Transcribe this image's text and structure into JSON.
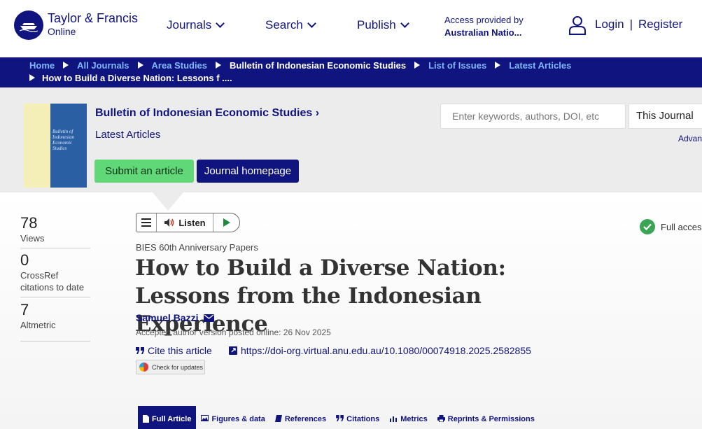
{
  "header": {
    "brand_line1": "Taylor & Francis",
    "brand_line2": "Online",
    "nav": [
      {
        "label": "Journals"
      },
      {
        "label": "Search"
      },
      {
        "label": "Publish"
      }
    ],
    "access_label": "Access provided by",
    "access_institution": "Australian Natio...",
    "login": "Login",
    "separator": "|",
    "register": "Register"
  },
  "breadcrumb": {
    "items": [
      "Home",
      "All Journals",
      "Area Studies",
      "Bulletin of Indonesian Economic Studies",
      "List of Issues",
      "Latest Articles"
    ],
    "current": "How to Build a Diverse Nation: Lessons f ...."
  },
  "journal": {
    "title": "Bulletin of Indonesian Economic Studies",
    "title_chevron": "›",
    "subtitle": "Latest Articles",
    "submit_label": "Submit an article",
    "homepage_label": "Journal homepage",
    "cover_text": "Bulletin of Indonesian Economic Studies"
  },
  "search": {
    "placeholder": "Enter keywords, authors, DOI, etc",
    "scope": "This Journal",
    "advanced": "Advan"
  },
  "metrics": [
    {
      "value": "78",
      "label": "Views"
    },
    {
      "value": "0",
      "label": "CrossRef citations to date"
    },
    {
      "value": "7",
      "label": "Altmetric"
    }
  ],
  "listen": {
    "label": "Listen"
  },
  "article": {
    "kicker": "BIES 60th Anniversary Papers",
    "title": "How to Build a Diverse Nation: Lessons from the Indonesian Experience",
    "author": "Samuel Bazzi",
    "posted": "Accepted author version posted online: 26 Nov 2025",
    "cite_label": "Cite this article",
    "doi": "https://doi-org.virtual.anu.edu.au/10.1080/00074918.2025.2582855",
    "check_updates": "Check for updates",
    "access_status": "Full access"
  },
  "tabs": [
    {
      "label": "Full Article",
      "icon": "document-icon"
    },
    {
      "label": "Figures & data",
      "icon": "image-icon"
    },
    {
      "label": "References",
      "icon": "book-icon"
    },
    {
      "label": "Citations",
      "icon": "quote-icon"
    },
    {
      "label": "Metrics",
      "icon": "bar-chart-icon"
    },
    {
      "label": "Reprints & Permissions",
      "icon": "print-icon"
    }
  ],
  "colors": {
    "brand": "#10147e",
    "breadcrumb_link": "#7fb8ff",
    "submit": "#60d878",
    "band": "#ececec",
    "access_ok": "#3aa655"
  }
}
